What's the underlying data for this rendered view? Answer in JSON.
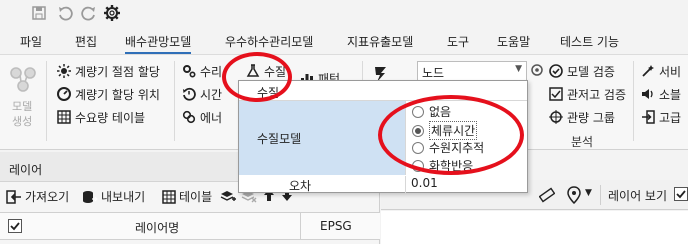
{
  "quick_access": {
    "icons": [
      "save-icon",
      "undo-icon",
      "redo-icon",
      "settings-icon"
    ]
  },
  "menu": {
    "tabs": [
      "파일",
      "편집",
      "배수관망모델",
      "우수하수관리모델",
      "지표유출모델",
      "도구",
      "도움말",
      "테스트 기능"
    ],
    "active": "배수관망모델"
  },
  "ribbon": {
    "model_create": "모델\n생성",
    "meter_node_assign": "계량기 절점 할당",
    "meter_assign_location": "계량기 할당 위치",
    "water_demand_table": "수요량 테이블",
    "water_service": "수리",
    "time": "시간",
    "energy": "에너",
    "water_quality": "수질",
    "pattern": "패턴",
    "node_combo": "노드",
    "model_check": "모델 검증",
    "pipe_calibration": "관저고 검증",
    "pipe_group": "관량 그룹",
    "analysis_group": "분석",
    "service_item": "서비",
    "valve_item": "소블",
    "advanced_item": "고급"
  },
  "popup": {
    "header_label": "수질",
    "model_label": "수질모델",
    "options": [
      "없음",
      "체류시간",
      "수원지추적",
      "화학반응"
    ],
    "selected": "체류시간",
    "error_label": "오차",
    "error_value": "0.01"
  },
  "panel": {
    "title": "레이어",
    "import": "가져오기",
    "export": "내보내기",
    "table": "테이블",
    "col_layer_name": "레이어명",
    "col_epsg": "EPSG"
  },
  "mapbar": {
    "layer_view": "레이어 보기"
  },
  "colors": {
    "annotation": "#e5101c",
    "selected_row": "#cfe1f3",
    "active_tab_underline": "#2f6fb8"
  }
}
